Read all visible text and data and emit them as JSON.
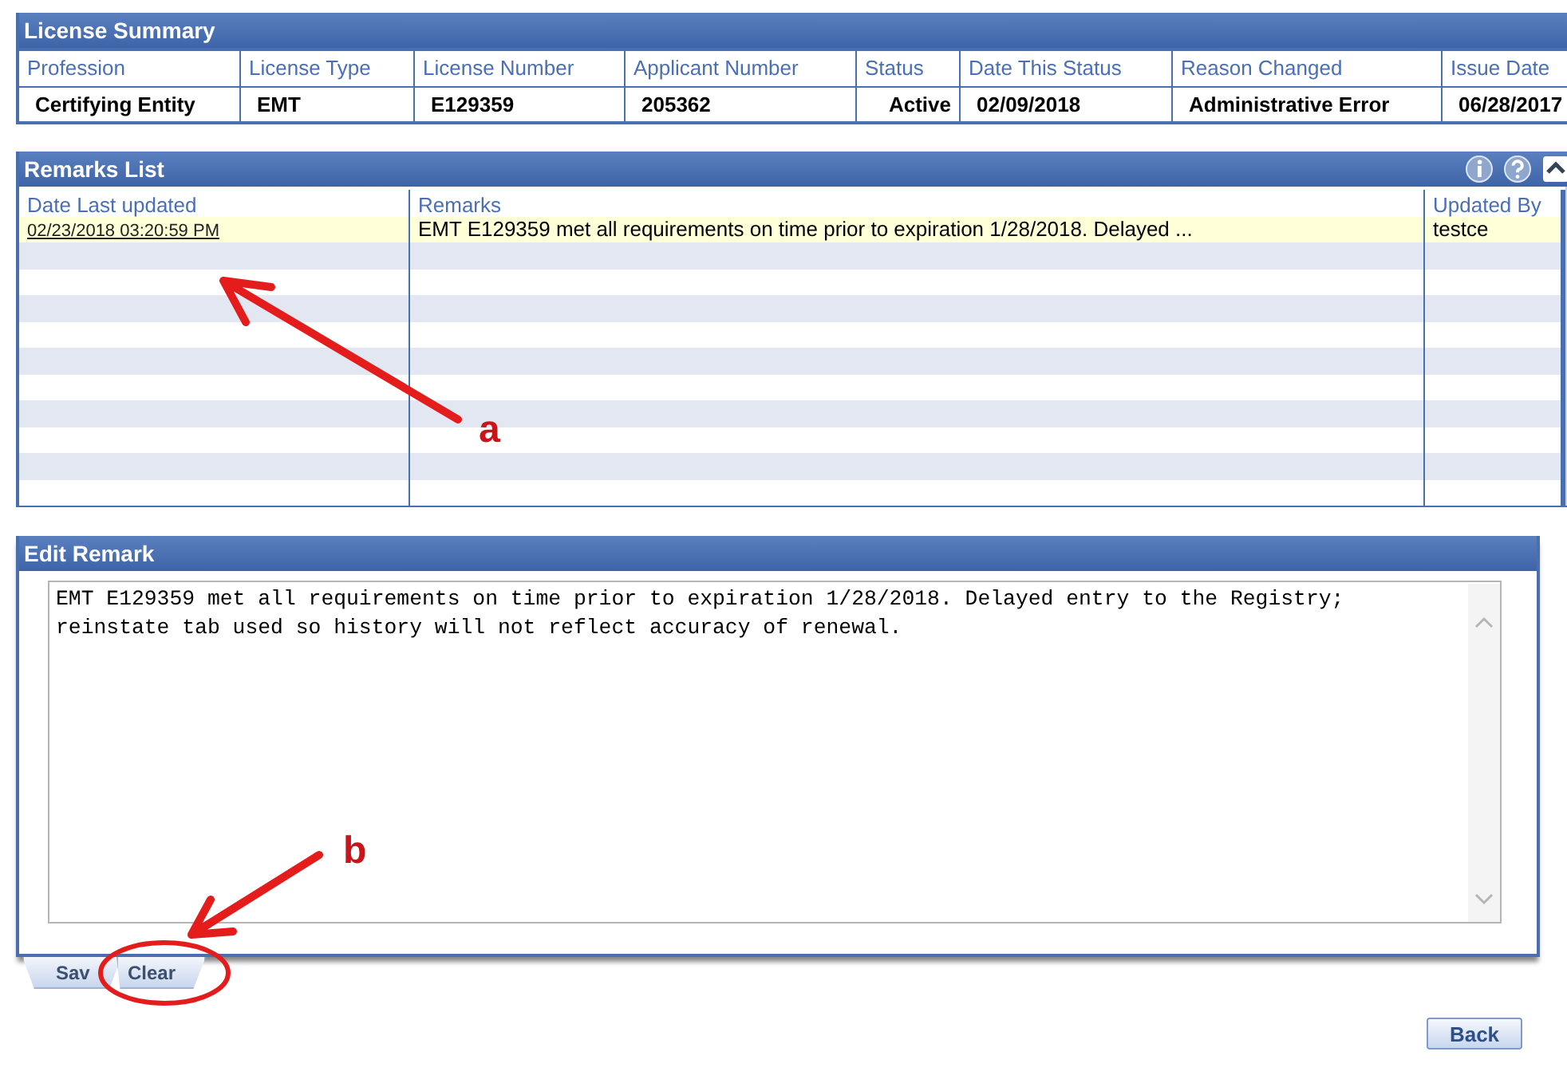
{
  "license_summary": {
    "title": "License Summary",
    "columns": [
      "Profession",
      "License Type",
      "License Number",
      "Applicant Number",
      "Status",
      "Date This Status",
      "Reason Changed",
      "Issue Date"
    ],
    "row": [
      "Certifying Entity",
      "EMT",
      "E129359",
      "205362",
      "Active",
      "02/09/2018",
      "Administrative Error",
      "06/28/2017"
    ]
  },
  "remarks_list": {
    "title": "Remarks List",
    "columns": [
      "Date Last updated",
      "Remarks",
      "Updated By"
    ],
    "rows": [
      {
        "date": "02/23/2018 03:20:59 PM",
        "remark": "EMT E129359 met all requirements on time prior to expiration 1/28/2018. Delayed ...",
        "updated_by": "testce",
        "selected": true
      }
    ]
  },
  "edit_remark": {
    "title": "Edit Remark",
    "value": "EMT E129359 met all requirements on time prior to expiration 1/28/2018. Delayed entry to the Registry; reinstate tab used so history will not reflect accuracy of renewal.",
    "tabs": [
      "Sav",
      "Clear"
    ]
  },
  "back_button": "Back",
  "annotations": [
    {
      "label": "a"
    },
    {
      "label": "b"
    }
  ]
}
